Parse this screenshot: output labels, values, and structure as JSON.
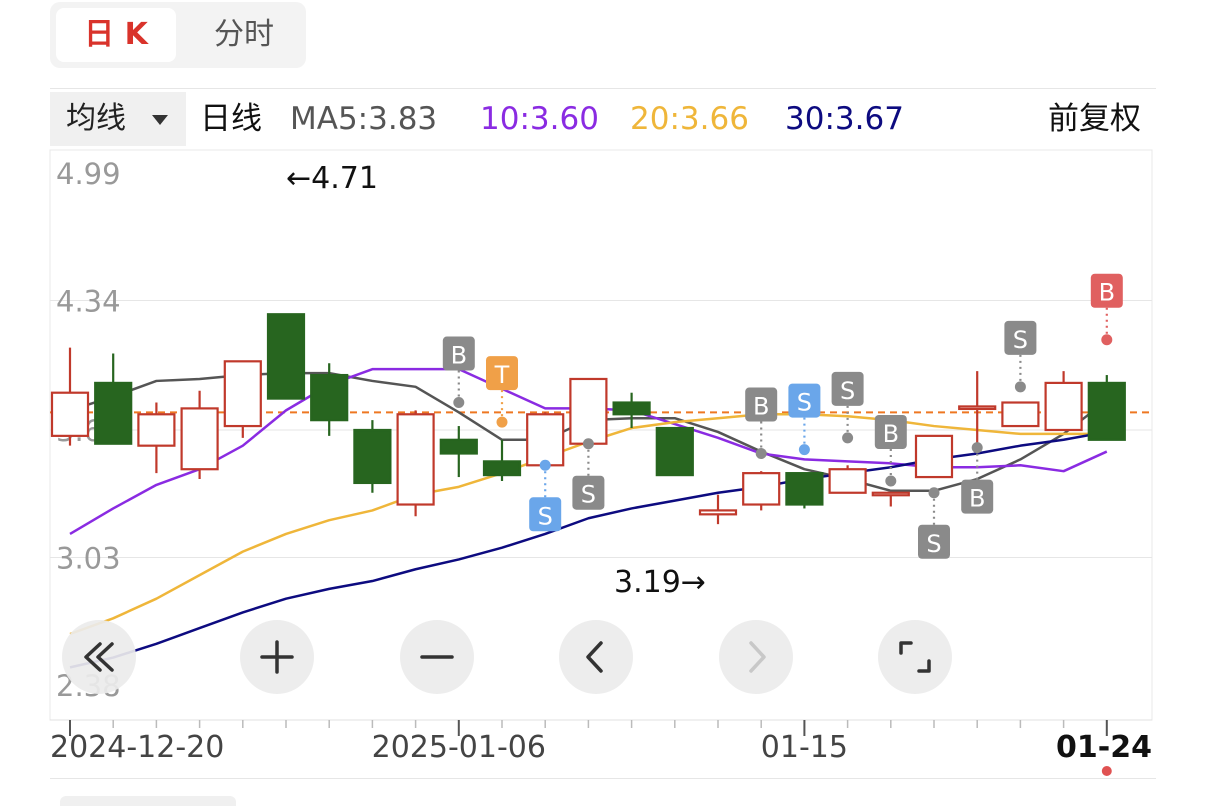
{
  "tabs": [
    {
      "label": "日 K",
      "active": true
    },
    {
      "label": "分时",
      "active": false
    }
  ],
  "header": {
    "ma_selector": "均线",
    "period": "日线",
    "ma5": "MA5:3.83",
    "ma10": "10:3.60",
    "ma20": "20:3.66",
    "ma30": "30:3.67",
    "adjust": "前复权"
  },
  "colors": {
    "up": "#c0392b",
    "down": "#27651f",
    "ma5": "#555555",
    "ma10": "#8a2be2",
    "ma20": "#efb63a",
    "ma30": "#0d0b80",
    "ref_line": "#ee7722"
  },
  "controls": [
    {
      "name": "fast-backward",
      "icon": "double-chevron-left-icon"
    },
    {
      "name": "zoom-in",
      "icon": "plus-icon"
    },
    {
      "name": "zoom-out",
      "icon": "minus-icon"
    },
    {
      "name": "previous",
      "icon": "chevron-left-icon"
    },
    {
      "name": "next",
      "icon": "chevron-right-icon"
    },
    {
      "name": "fullscreen",
      "icon": "fullscreen-icon"
    }
  ],
  "chart_data": {
    "type": "candlestick",
    "y_ticks": [
      "4.99",
      "4.34",
      "3.68",
      "3.03",
      "2.38"
    ],
    "ylim": [
      2.38,
      4.99
    ],
    "x_ticks": [
      {
        "label": "2024-12-20",
        "index": 0
      },
      {
        "label": "2025-01-06",
        "index": 9
      },
      {
        "label": "01-15",
        "index": 17
      },
      {
        "label": "01-24",
        "index": 24
      }
    ],
    "high_label": "←4.71",
    "low_label": "3.19→",
    "ref_price": 3.77,
    "candles": [
      {
        "o": 3.65,
        "h": 4.1,
        "l": 3.6,
        "c": 3.87
      },
      {
        "o": 3.92,
        "h": 4.07,
        "l": 3.68,
        "c": 3.61
      },
      {
        "o": 3.6,
        "h": 3.82,
        "l": 3.46,
        "c": 3.76
      },
      {
        "o": 3.48,
        "h": 3.88,
        "l": 3.43,
        "c": 3.79
      },
      {
        "o": 3.7,
        "h": 4.02,
        "l": 3.64,
        "c": 4.03
      },
      {
        "o": 4.27,
        "h": 4.27,
        "l": 3.84,
        "c": 3.84
      },
      {
        "o": 3.96,
        "h": 4.02,
        "l": 3.65,
        "c": 3.73
      },
      {
        "o": 3.68,
        "h": 3.73,
        "l": 3.36,
        "c": 3.41
      },
      {
        "o": 3.3,
        "h": 3.78,
        "l": 3.24,
        "c": 3.76
      },
      {
        "o": 3.63,
        "h": 3.7,
        "l": 3.44,
        "c": 3.56
      },
      {
        "o": 3.52,
        "h": 3.63,
        "l": 3.42,
        "c": 3.45
      },
      {
        "o": 3.5,
        "h": 3.77,
        "l": 3.49,
        "c": 3.76
      },
      {
        "o": 3.61,
        "h": 3.9,
        "l": 3.61,
        "c": 3.94
      },
      {
        "o": 3.82,
        "h": 3.87,
        "l": 3.69,
        "c": 3.76
      },
      {
        "o": 3.69,
        "h": 3.69,
        "l": 3.45,
        "c": 3.45
      },
      {
        "o": 3.25,
        "h": 3.35,
        "l": 3.2,
        "c": 3.27
      },
      {
        "o": 3.3,
        "h": 3.47,
        "l": 3.27,
        "c": 3.46
      },
      {
        "o": 3.46,
        "h": 3.46,
        "l": 3.28,
        "c": 3.3
      },
      {
        "o": 3.36,
        "h": 3.5,
        "l": 3.36,
        "c": 3.48
      },
      {
        "o": 3.36,
        "h": 3.36,
        "l": 3.29,
        "c": 3.36
      },
      {
        "o": 3.44,
        "h": 3.65,
        "l": 3.44,
        "c": 3.65
      },
      {
        "o": 3.8,
        "h": 3.98,
        "l": 3.59,
        "c": 3.8
      },
      {
        "o": 3.7,
        "h": 3.8,
        "l": 3.7,
        "c": 3.82
      },
      {
        "o": 3.68,
        "h": 3.98,
        "l": 3.68,
        "c": 3.92
      },
      {
        "o": 3.92,
        "h": 3.96,
        "l": 3.66,
        "c": 3.63
      }
    ],
    "series": [
      {
        "name": "MA5",
        "x": [
          0,
          1,
          2,
          3,
          4,
          5,
          6,
          7,
          8,
          9,
          10,
          11,
          12,
          13,
          14,
          15,
          16,
          17,
          18,
          19,
          20,
          21,
          22,
          23,
          24
        ],
        "values": [
          3.78,
          3.85,
          3.93,
          3.94,
          3.96,
          3.97,
          3.97,
          3.93,
          3.9,
          3.77,
          3.63,
          3.63,
          3.73,
          3.74,
          3.74,
          3.67,
          3.57,
          3.48,
          3.43,
          3.37,
          3.37,
          3.43,
          3.53,
          3.66,
          3.83
        ]
      },
      {
        "name": "10",
        "x": [
          0,
          1,
          2,
          3,
          4,
          5,
          6,
          7,
          8,
          9,
          10,
          11,
          12,
          13,
          14,
          15,
          16,
          17,
          18,
          19,
          20,
          21,
          22,
          23,
          24
        ],
        "values": [
          3.15,
          3.28,
          3.4,
          3.48,
          3.6,
          3.78,
          3.91,
          3.99,
          3.99,
          3.99,
          3.89,
          3.79,
          3.79,
          3.78,
          3.71,
          3.64,
          3.56,
          3.53,
          3.52,
          3.51,
          3.49,
          3.49,
          3.5,
          3.47,
          3.57
        ]
      },
      {
        "name": "20",
        "x": [
          0,
          1,
          2,
          3,
          4,
          5,
          6,
          7,
          8,
          9,
          10,
          11,
          12,
          13,
          14,
          15,
          16,
          17,
          18,
          19,
          20,
          21,
          22,
          23,
          24
        ],
        "values": [
          2.64,
          2.72,
          2.82,
          2.94,
          3.06,
          3.15,
          3.22,
          3.27,
          3.35,
          3.39,
          3.46,
          3.54,
          3.62,
          3.69,
          3.72,
          3.74,
          3.76,
          3.76,
          3.75,
          3.73,
          3.7,
          3.68,
          3.66,
          3.66,
          3.66
        ]
      },
      {
        "name": "30",
        "x": [
          0,
          1,
          2,
          3,
          4,
          5,
          6,
          7,
          8,
          9,
          10,
          11,
          12,
          13,
          14,
          15,
          16,
          17,
          18,
          19,
          20,
          21,
          22,
          23,
          24
        ],
        "values": [
          2.47,
          2.52,
          2.59,
          2.67,
          2.75,
          2.82,
          2.87,
          2.91,
          2.97,
          3.02,
          3.08,
          3.15,
          3.23,
          3.28,
          3.32,
          3.36,
          3.39,
          3.43,
          3.46,
          3.49,
          3.53,
          3.56,
          3.6,
          3.63,
          3.67
        ]
      }
    ],
    "markers": [
      {
        "label": "B",
        "index": 9,
        "price": 3.82,
        "side": "above",
        "style": "gray"
      },
      {
        "label": "T",
        "index": 10,
        "price": 3.72,
        "side": "above",
        "style": "orange"
      },
      {
        "label": "S",
        "index": 11,
        "price": 3.5,
        "side": "below",
        "style": "blue"
      },
      {
        "label": "S",
        "index": 12,
        "price": 3.61,
        "side": "below",
        "style": "gray"
      },
      {
        "label": "B",
        "index": 16,
        "price": 3.56,
        "side": "above",
        "style": "gray"
      },
      {
        "label": "S",
        "index": 17,
        "price": 3.58,
        "side": "above",
        "style": "blue"
      },
      {
        "label": "S",
        "index": 18,
        "price": 3.64,
        "side": "above",
        "style": "gray"
      },
      {
        "label": "B",
        "index": 19,
        "price": 3.42,
        "side": "above",
        "style": "gray"
      },
      {
        "label": "S",
        "index": 20,
        "price": 3.36,
        "side": "below",
        "style": "gray"
      },
      {
        "label": "B",
        "index": 21,
        "price": 3.59,
        "side": "below",
        "style": "gray"
      },
      {
        "label": "S",
        "index": 22,
        "price": 3.9,
        "side": "above",
        "style": "gray"
      },
      {
        "label": "B",
        "index": 24,
        "price": 4.14,
        "side": "above",
        "style": "red"
      }
    ]
  }
}
